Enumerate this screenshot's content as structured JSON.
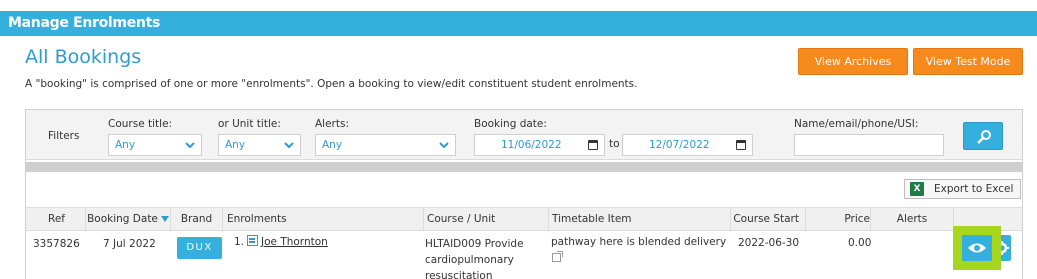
{
  "header": {
    "title": "Manage Enrolments"
  },
  "page": {
    "title": "All Bookings",
    "description": "A \"booking\" is comprised of one or more \"enrolments\". Open a booking to view/edit constituent student enrolments."
  },
  "actions": {
    "view_archives": "View Archives",
    "view_test_mode": "View Test Mode"
  },
  "filters": {
    "label": "Filters",
    "course_title_label": "Course title:",
    "course_title_value": "Any",
    "unit_title_label": "or Unit title:",
    "unit_title_value": "Any",
    "alerts_label": "Alerts:",
    "alerts_value": "Any",
    "booking_date_label": "Booking date:",
    "date_from": "11/06/2022",
    "to_label": "to",
    "date_to": "12/07/2022",
    "search_label": "Name/email/phone/USI:",
    "search_value": ""
  },
  "export": {
    "label": "Export to Excel",
    "icon": "excel-icon"
  },
  "table": {
    "columns": [
      "Ref",
      "Booking Date",
      "Brand",
      "Enrolments",
      "Course / Unit",
      "Timetable Item",
      "Course Start",
      "Price",
      "Alerts"
    ],
    "rows": [
      {
        "ref": "3357826",
        "booking_date": "7 Jul 2022",
        "brand": "DUX",
        "enrolment_num": "1.",
        "enrolment_name": "Joe Thornton",
        "course_unit": "HLTAID009 Provide cardiopulmonary resuscitation",
        "timetable": "pathway here is blended delivery",
        "course_start": "2022-06-30",
        "price": "0.00",
        "alerts": ""
      }
    ]
  },
  "colors": {
    "accent": "#35b0de",
    "orange": "#f78a1d",
    "highlight": "#a7d61f"
  }
}
